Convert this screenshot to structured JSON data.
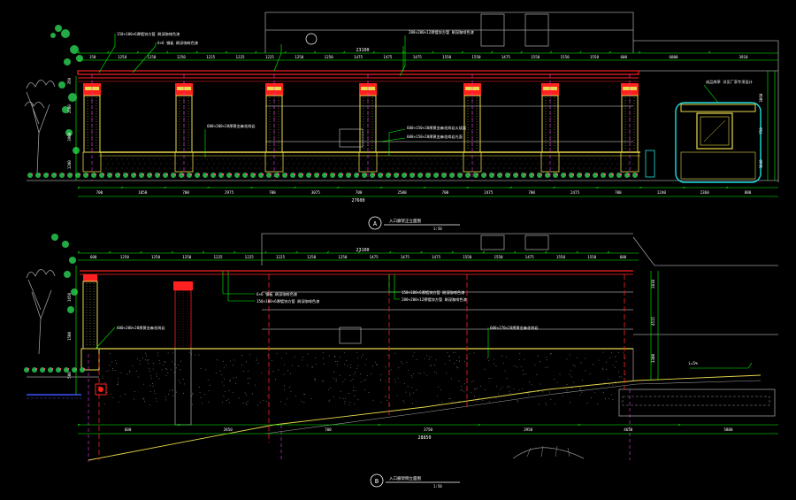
{
  "colors": {
    "background": "#000000",
    "dimension": "#00ff00",
    "structure_red": "#ff2020",
    "column_yellow": "#e8d84a",
    "building_grey": "#9a9a9a",
    "ground_blue": "#3a50ff",
    "magenta_axis": "#ff30ff",
    "cyan_booth": "#20e0e0",
    "leader_white": "#ffffff",
    "plant_green": "#22aa44",
    "flower_pink": "#ff5090"
  },
  "elevation_a": {
    "overall_dim": "23100",
    "top_dims": [
      "150",
      "1250",
      "1250",
      "1250",
      "1225",
      "1225",
      "1225",
      "1250",
      "1250",
      "1475",
      "1475",
      "1475",
      "1550",
      "1550",
      "1475",
      "1550",
      "1550",
      "1550",
      "600"
    ],
    "right_dims": [
      "6000",
      "3910"
    ],
    "bottom_dims": [
      "700",
      "1850",
      "700",
      "2975",
      "700",
      "3075",
      "700",
      "2500",
      "700",
      "2475",
      "700",
      "2475",
      "700",
      "1240",
      "2360",
      "880"
    ],
    "overall_bottom": "27600",
    "height_dims": [
      "350",
      "2600",
      "3900",
      "1200"
    ],
    "booth_heights": [
      "3060",
      "750",
      "3840"
    ],
    "notes": [
      "150×100×6厚镀锌方管 刷深咖啡色漆",
      "6×6 钢板 刷深咖啡色漆",
      "200×200×12厚镀锌方管 刷深咖啡色漆",
      "600×200×20厚黄金麻花岗岩",
      "600×150×30厚黄金麻花岗岩火烧面",
      "600×150×20厚黄金麻花岗岩光面",
      "成品岗亭 详见厂家专项设计"
    ],
    "marker": "A",
    "title": "入口廊架正立面图",
    "scale": "1:50"
  },
  "elevation_b": {
    "overall_dim": "23100",
    "top_dims": [
      "600",
      "1250",
      "1250",
      "1250",
      "1225",
      "1225",
      "1225",
      "1250",
      "1250",
      "1475",
      "1475",
      "1475",
      "1550",
      "1550",
      "1475",
      "1550",
      "1550",
      "600"
    ],
    "bottom_dims": [
      "600",
      "2850",
      "700",
      "3750",
      "3950",
      "4650",
      "5800"
    ],
    "overall_bottom": "28850",
    "height_dims": [
      "1650",
      "1500",
      "500"
    ],
    "right_heights": [
      "2810",
      "4515",
      "3300"
    ],
    "notes": [
      "6×6 钢板 刷深咖啡色漆",
      "150×100×6厚镀锌方管 刷深咖啡色漆",
      "150×100×6厚镀锌方管 刷深咖啡色漆",
      "200×200×12厚镀锌方管 刷深咖啡色漆",
      "600×200×20厚黄金麻花岗岩",
      "600×270×20厚黄金麻花岗岩"
    ],
    "slope_label": "i=5%",
    "marker": "B",
    "title": "入口廊架侧立面图",
    "scale": "1:50"
  }
}
